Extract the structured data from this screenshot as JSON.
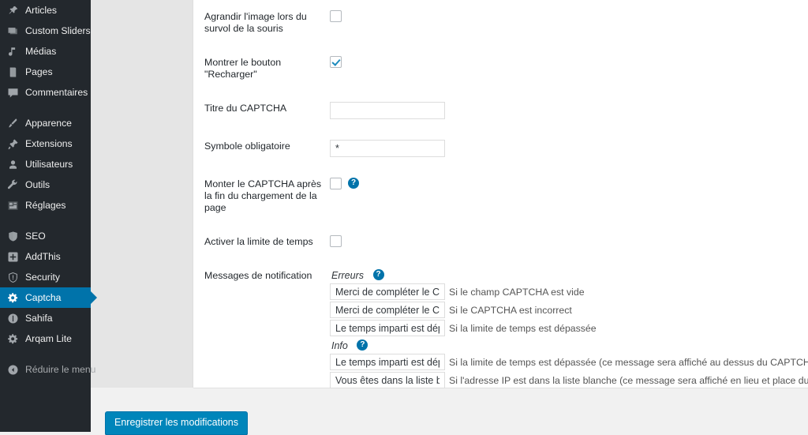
{
  "sidebar": {
    "items": [
      {
        "label": "Articles",
        "icon": "pin-icon",
        "current": false,
        "sep_after": false
      },
      {
        "label": "Custom Sliders",
        "icon": "slider-icon",
        "current": false,
        "sep_after": false
      },
      {
        "label": "Médias",
        "icon": "media-icon",
        "current": false,
        "sep_after": false
      },
      {
        "label": "Pages",
        "icon": "page-icon",
        "current": false,
        "sep_after": false
      },
      {
        "label": "Commentaires",
        "icon": "comment-icon",
        "current": false,
        "sep_after": true
      },
      {
        "label": "Apparence",
        "icon": "brush-icon",
        "current": false,
        "sep_after": false
      },
      {
        "label": "Extensions",
        "icon": "plugin-icon",
        "current": false,
        "sep_after": false
      },
      {
        "label": "Utilisateurs",
        "icon": "user-icon",
        "current": false,
        "sep_after": false
      },
      {
        "label": "Outils",
        "icon": "wrench-icon",
        "current": false,
        "sep_after": false
      },
      {
        "label": "Réglages",
        "icon": "settings-icon",
        "current": false,
        "sep_after": true
      },
      {
        "label": "SEO",
        "icon": "seo-icon",
        "current": false,
        "sep_after": false
      },
      {
        "label": "AddThis",
        "icon": "addthis-plus-icon",
        "current": false,
        "sep_after": false
      },
      {
        "label": "Security",
        "icon": "shield-icon",
        "current": false,
        "sep_after": false
      },
      {
        "label": "Captcha",
        "icon": "gear-icon",
        "current": true,
        "sep_after": false
      },
      {
        "label": "Sahifa",
        "icon": "info-circle-icon",
        "current": false,
        "sep_after": false
      },
      {
        "label": "Arqam Lite",
        "icon": "gear-icon",
        "current": false,
        "sep_after": true
      },
      {
        "label": "Réduire le menu",
        "icon": "collapse-arrow-icon",
        "current": false,
        "sep_after": false
      }
    ],
    "highlight_color": "#0073aa",
    "background_color": "#23282d"
  },
  "form": {
    "rows": {
      "enlarge_image": {
        "label": "Agrandir l'image lors du survol de la souris",
        "checked": false
      },
      "show_refresh_button": {
        "label": "Montrer le bouton \"Recharger\"",
        "checked": true
      },
      "captcha_title": {
        "label": "Titre du CAPTCHA",
        "value": "",
        "placeholder": ""
      },
      "required_symbol": {
        "label": "Symbole obligatoire",
        "value": "*",
        "placeholder": ""
      },
      "mount_after_load": {
        "label": "Monter le CAPTCHA après la fin du chargement de la page",
        "checked": false,
        "help": "?"
      },
      "enable_time_limit": {
        "label": "Activer la limite de temps",
        "checked": false
      },
      "notification_messages": {
        "label": "Messages de notification",
        "groups": [
          {
            "title": "Erreurs",
            "help": "?",
            "fields": [
              {
                "value": "Merci de compléter le CAPTCHA",
                "description": "Si le champ CAPTCHA est vide"
              },
              {
                "value": "Merci de compléter le CAPTCHA",
                "description": "Si le CAPTCHA est incorrect"
              },
              {
                "value": "Le temps imparti est dépassé",
                "description": "Si la limite de temps est dépassée"
              }
            ]
          },
          {
            "title": "Info",
            "help": "?",
            "fields": [
              {
                "value": "Le temps imparti est dépassé",
                "description": "Si la limite de temps est dépassée (ce message sera affiché au dessus du CAPTCHA)"
              },
              {
                "value": "Vous êtes dans la liste blanche",
                "description": "Si l'adresse IP est dans la liste blanche (ce message sera affiché en lieu et place du CAPTCHA)."
              }
            ]
          }
        ]
      }
    }
  },
  "footer": {
    "submit_label": "Enregistrer les modifications",
    "submit_color": "#0085ba"
  }
}
